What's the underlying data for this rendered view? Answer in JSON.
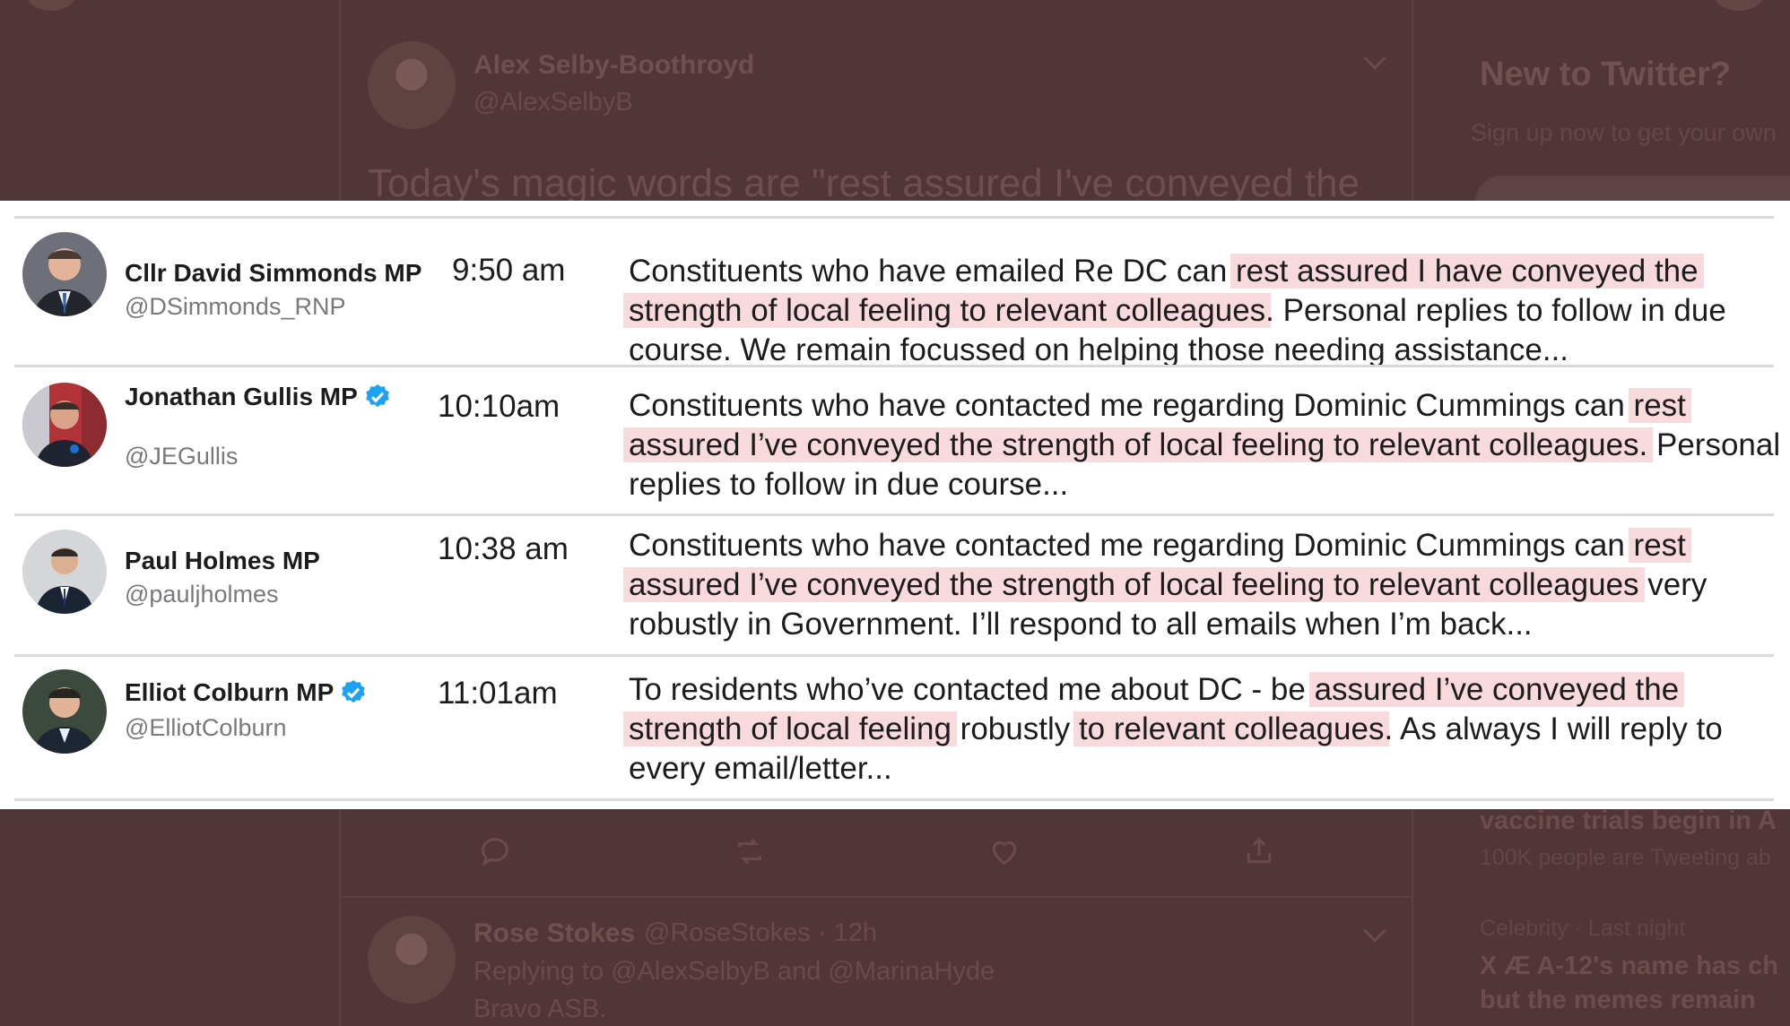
{
  "background": {
    "author_name": "Alex Selby-Boothroyd",
    "author_handle": "@AlexSelbyB",
    "tweet_text": "Today's magic words are \"rest assured I've conveyed the",
    "sidebar_title": "New to Twitter?",
    "sidebar_subtitle": "Sign up now to get your own",
    "trend_1_title": "vaccine trials begin in A",
    "trend_1_meta": "100K people are Tweeting ab",
    "trend_2_category": "Celebrity · Last night",
    "trend_2_line1": "X Æ A-12's name has ch",
    "trend_2_line2": "but the memes remain",
    "reply_name": "Rose Stokes",
    "reply_handle_time": "@RoseStokes · 12h",
    "reply_replying_to": "Replying to @AlexSelbyB and @MarinaHyde",
    "reply_text": "Bravo ASB.",
    "icons": [
      "reply-icon",
      "retweet-icon",
      "like-icon",
      "share-icon",
      "verified-icon",
      "chevron-down-icon"
    ]
  },
  "tweets": [
    {
      "name": "Cllr David Simmonds MP",
      "handle": "@DSimmonds_RNP",
      "verified": false,
      "time": "9:50 am",
      "parts": [
        {
          "t": "Constituents who have emailed Re DC can ",
          "hl": false
        },
        {
          "t": "rest assured I have conveyed the strength of local feeling to relevant colleagues",
          "hl": true
        },
        {
          "t": ". Personal replies to follow in due course. We remain focussed on helping those needing assistance...",
          "hl": false
        }
      ]
    },
    {
      "name": "Jonathan Gullis MP",
      "handle": "@JEGullis",
      "verified": true,
      "time": "10:10am",
      "parts": [
        {
          "t": "Constituents who have contacted me regarding Dominic Cummings can ",
          "hl": false
        },
        {
          "t": "rest assured I’ve conveyed the strength of local feeling to relevant colleagues.",
          "hl": true
        },
        {
          "t": " Personal replies to follow in due course...",
          "hl": false
        }
      ]
    },
    {
      "name": "Paul Holmes MP",
      "handle": "@pauljholmes",
      "verified": false,
      "time": "10:38 am",
      "parts": [
        {
          "t": "Constituents who have contacted me regarding Dominic Cummings can ",
          "hl": false
        },
        {
          "t": "rest assured I’ve conveyed the strength of local feeling to relevant colleagues",
          "hl": true
        },
        {
          "t": " very robustly in Government. I’ll respond to all emails when I’m back...",
          "hl": false
        }
      ]
    },
    {
      "name": "Elliot Colburn MP",
      "handle": "@ElliotColburn",
      "verified": true,
      "time": "11:01am",
      "parts": [
        {
          "t": "To residents who’ve contacted me about DC - be ",
          "hl": false
        },
        {
          "t": "assured I’ve conveyed the strength of local feeling",
          "hl": true
        },
        {
          "t": " robustly ",
          "hl": false
        },
        {
          "t": "to relevant colleagues",
          "hl": true
        },
        {
          "t": ". As always I will reply to every email/letter...",
          "hl": false
        }
      ]
    }
  ],
  "colors": {
    "highlight": "#f8d9dc",
    "verified": "#1da1f2",
    "overlay_bg": "#523637"
  }
}
